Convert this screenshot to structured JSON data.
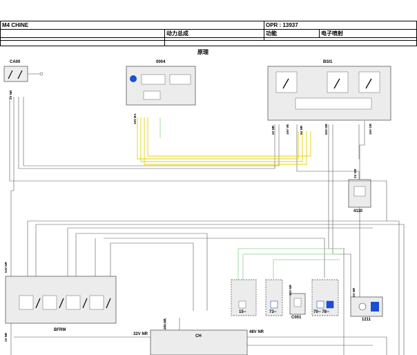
{
  "header": {
    "model": "M4 CHINE",
    "opr": "OPR : 13937",
    "domain_cn": "动力总成",
    "function_label": "功能",
    "function_value": "电子喷射",
    "section_title": "原理"
  },
  "components": {
    "ca00": "CA00",
    "c0004": "0004",
    "bsi1": "BSI1",
    "c4110": "4110",
    "bfrm": "BFRM",
    "c15": "15--",
    "c73": "73--",
    "c001": "C001",
    "c70_78": "70-- 78--",
    "c1211": "1211",
    "ch": "CH"
  },
  "wire_labels": {
    "w_2v_nr": "2V NR",
    "w_16v_ba": "16V BA",
    "w_2v_nr_b": "2V NR",
    "w_16v_ve": "16V VE",
    "w_6v_nr": "6V NR",
    "w_60v_nr": "60V NR",
    "w_16v_gr": "16V GR",
    "w_2v_gr": "2V GR",
    "w_54v_nr": "54V NR",
    "w_1v_nr": "1V NR",
    "w_32v_nr": "32V NR",
    "w_28v_nr": "28V NR",
    "w_48v_nr": "48V NR",
    "w_16v_nr": "16V NR",
    "w_4v_nr": "4V NR"
  },
  "colors": {
    "line": "#444444",
    "yellow": "#e6d200",
    "green": "#8fd08f",
    "box_fill": "#ececec",
    "blue_icon": "#1a4fd0"
  }
}
